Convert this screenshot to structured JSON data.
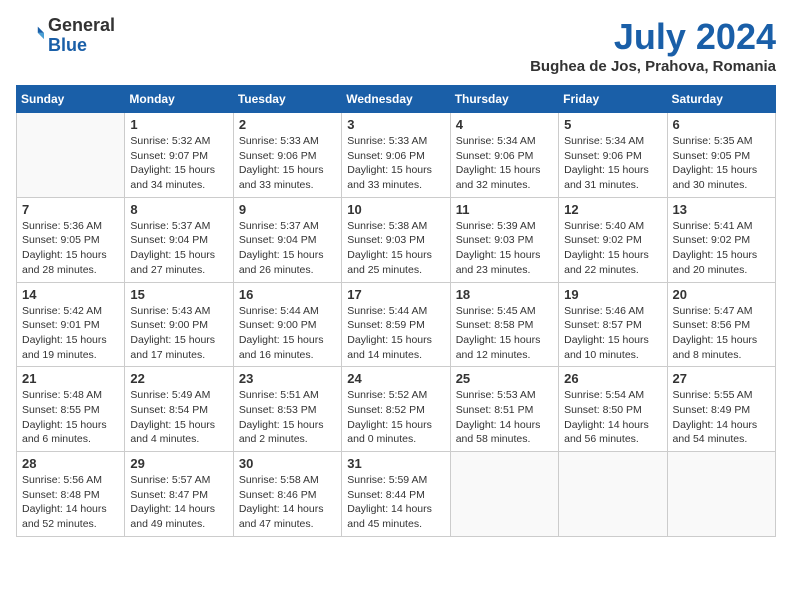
{
  "header": {
    "logo_line1": "General",
    "logo_line2": "Blue",
    "month": "July 2024",
    "location": "Bughea de Jos, Prahova, Romania"
  },
  "weekdays": [
    "Sunday",
    "Monday",
    "Tuesday",
    "Wednesday",
    "Thursday",
    "Friday",
    "Saturday"
  ],
  "weeks": [
    [
      {
        "day": "",
        "info": ""
      },
      {
        "day": "1",
        "info": "Sunrise: 5:32 AM\nSunset: 9:07 PM\nDaylight: 15 hours\nand 34 minutes."
      },
      {
        "day": "2",
        "info": "Sunrise: 5:33 AM\nSunset: 9:06 PM\nDaylight: 15 hours\nand 33 minutes."
      },
      {
        "day": "3",
        "info": "Sunrise: 5:33 AM\nSunset: 9:06 PM\nDaylight: 15 hours\nand 33 minutes."
      },
      {
        "day": "4",
        "info": "Sunrise: 5:34 AM\nSunset: 9:06 PM\nDaylight: 15 hours\nand 32 minutes."
      },
      {
        "day": "5",
        "info": "Sunrise: 5:34 AM\nSunset: 9:06 PM\nDaylight: 15 hours\nand 31 minutes."
      },
      {
        "day": "6",
        "info": "Sunrise: 5:35 AM\nSunset: 9:05 PM\nDaylight: 15 hours\nand 30 minutes."
      }
    ],
    [
      {
        "day": "7",
        "info": "Sunrise: 5:36 AM\nSunset: 9:05 PM\nDaylight: 15 hours\nand 28 minutes."
      },
      {
        "day": "8",
        "info": "Sunrise: 5:37 AM\nSunset: 9:04 PM\nDaylight: 15 hours\nand 27 minutes."
      },
      {
        "day": "9",
        "info": "Sunrise: 5:37 AM\nSunset: 9:04 PM\nDaylight: 15 hours\nand 26 minutes."
      },
      {
        "day": "10",
        "info": "Sunrise: 5:38 AM\nSunset: 9:03 PM\nDaylight: 15 hours\nand 25 minutes."
      },
      {
        "day": "11",
        "info": "Sunrise: 5:39 AM\nSunset: 9:03 PM\nDaylight: 15 hours\nand 23 minutes."
      },
      {
        "day": "12",
        "info": "Sunrise: 5:40 AM\nSunset: 9:02 PM\nDaylight: 15 hours\nand 22 minutes."
      },
      {
        "day": "13",
        "info": "Sunrise: 5:41 AM\nSunset: 9:02 PM\nDaylight: 15 hours\nand 20 minutes."
      }
    ],
    [
      {
        "day": "14",
        "info": "Sunrise: 5:42 AM\nSunset: 9:01 PM\nDaylight: 15 hours\nand 19 minutes."
      },
      {
        "day": "15",
        "info": "Sunrise: 5:43 AM\nSunset: 9:00 PM\nDaylight: 15 hours\nand 17 minutes."
      },
      {
        "day": "16",
        "info": "Sunrise: 5:44 AM\nSunset: 9:00 PM\nDaylight: 15 hours\nand 16 minutes."
      },
      {
        "day": "17",
        "info": "Sunrise: 5:44 AM\nSunset: 8:59 PM\nDaylight: 15 hours\nand 14 minutes."
      },
      {
        "day": "18",
        "info": "Sunrise: 5:45 AM\nSunset: 8:58 PM\nDaylight: 15 hours\nand 12 minutes."
      },
      {
        "day": "19",
        "info": "Sunrise: 5:46 AM\nSunset: 8:57 PM\nDaylight: 15 hours\nand 10 minutes."
      },
      {
        "day": "20",
        "info": "Sunrise: 5:47 AM\nSunset: 8:56 PM\nDaylight: 15 hours\nand 8 minutes."
      }
    ],
    [
      {
        "day": "21",
        "info": "Sunrise: 5:48 AM\nSunset: 8:55 PM\nDaylight: 15 hours\nand 6 minutes."
      },
      {
        "day": "22",
        "info": "Sunrise: 5:49 AM\nSunset: 8:54 PM\nDaylight: 15 hours\nand 4 minutes."
      },
      {
        "day": "23",
        "info": "Sunrise: 5:51 AM\nSunset: 8:53 PM\nDaylight: 15 hours\nand 2 minutes."
      },
      {
        "day": "24",
        "info": "Sunrise: 5:52 AM\nSunset: 8:52 PM\nDaylight: 15 hours\nand 0 minutes."
      },
      {
        "day": "25",
        "info": "Sunrise: 5:53 AM\nSunset: 8:51 PM\nDaylight: 14 hours\nand 58 minutes."
      },
      {
        "day": "26",
        "info": "Sunrise: 5:54 AM\nSunset: 8:50 PM\nDaylight: 14 hours\nand 56 minutes."
      },
      {
        "day": "27",
        "info": "Sunrise: 5:55 AM\nSunset: 8:49 PM\nDaylight: 14 hours\nand 54 minutes."
      }
    ],
    [
      {
        "day": "28",
        "info": "Sunrise: 5:56 AM\nSunset: 8:48 PM\nDaylight: 14 hours\nand 52 minutes."
      },
      {
        "day": "29",
        "info": "Sunrise: 5:57 AM\nSunset: 8:47 PM\nDaylight: 14 hours\nand 49 minutes."
      },
      {
        "day": "30",
        "info": "Sunrise: 5:58 AM\nSunset: 8:46 PM\nDaylight: 14 hours\nand 47 minutes."
      },
      {
        "day": "31",
        "info": "Sunrise: 5:59 AM\nSunset: 8:44 PM\nDaylight: 14 hours\nand 45 minutes."
      },
      {
        "day": "",
        "info": ""
      },
      {
        "day": "",
        "info": ""
      },
      {
        "day": "",
        "info": ""
      }
    ]
  ]
}
